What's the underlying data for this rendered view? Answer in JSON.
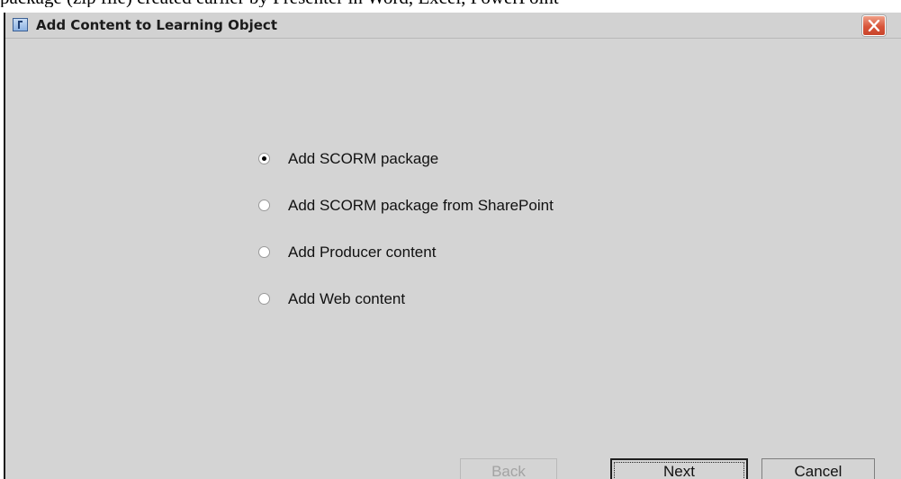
{
  "background_text": "package (zip file) created earlier by Presenter in Word, Excel, PowerPoint",
  "window": {
    "title": "Add Content to Learning Object"
  },
  "options": [
    {
      "label": "Add SCORM package",
      "checked": true
    },
    {
      "label": "Add SCORM package from SharePoint",
      "checked": false
    },
    {
      "label": "Add Producer content",
      "checked": false
    },
    {
      "label": "Add Web content",
      "checked": false
    }
  ],
  "buttons": {
    "back": "Back",
    "next": "Next",
    "cancel": "Cancel"
  },
  "colors": {
    "window_bg": "#d4d4d4",
    "close_button": "#d8553a"
  },
  "icons": {
    "app": "app-icon",
    "close": "close-icon",
    "radio_checked": "radio-checked",
    "radio_unchecked": "radio-unchecked"
  }
}
